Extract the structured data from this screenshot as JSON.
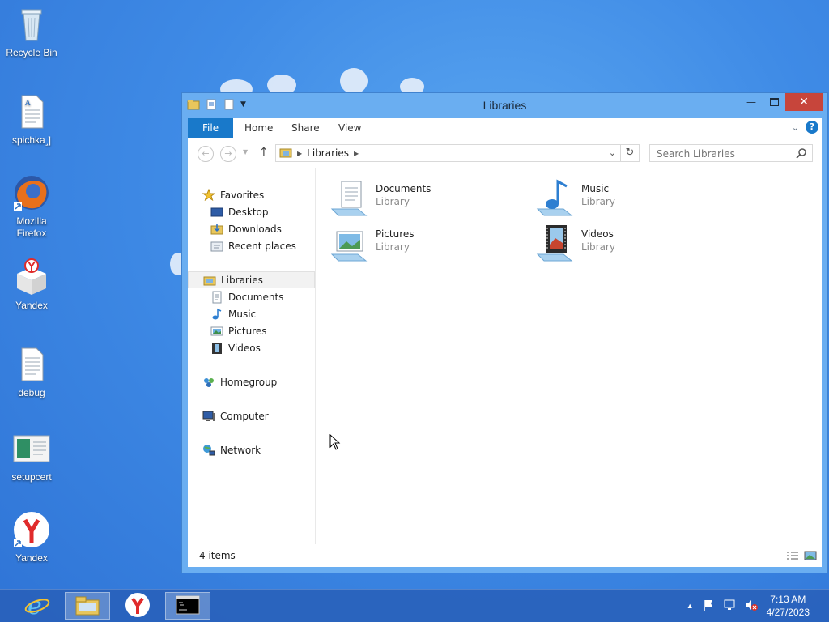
{
  "desktop": {
    "icons": [
      {
        "label": "Recycle Bin"
      },
      {
        "label": "spichka˼]"
      },
      {
        "label": "Mozilla Firefox"
      },
      {
        "label": "Yandex"
      },
      {
        "label": "debug"
      },
      {
        "label": "setupcert"
      },
      {
        "label": "Yandex"
      }
    ]
  },
  "window": {
    "title": "Libraries",
    "ribbon_tabs": [
      {
        "label": "File"
      },
      {
        "label": "Home"
      },
      {
        "label": "Share"
      },
      {
        "label": "View"
      }
    ],
    "help_label": "?",
    "address": {
      "crumb": "Libraries"
    },
    "search": {
      "placeholder": "Search Libraries"
    },
    "nav": {
      "favorites": {
        "label": "Favorites",
        "items": [
          "Desktop",
          "Downloads",
          "Recent places"
        ]
      },
      "libraries": {
        "label": "Libraries",
        "items": [
          "Documents",
          "Music",
          "Pictures",
          "Videos"
        ]
      },
      "homegroup": "Homegroup",
      "computer": "Computer",
      "network": "Network"
    },
    "content": [
      {
        "name": "Documents",
        "sub": "Library"
      },
      {
        "name": "Music",
        "sub": "Library"
      },
      {
        "name": "Pictures",
        "sub": "Library"
      },
      {
        "name": "Videos",
        "sub": "Library"
      }
    ],
    "status": "4 items"
  },
  "taskbar": {
    "time": "7:13 AM",
    "date": "4/27/2023"
  },
  "colors": {
    "accent": "#1979ca",
    "close": "#c7453b",
    "desktop": "#3f8be6"
  }
}
